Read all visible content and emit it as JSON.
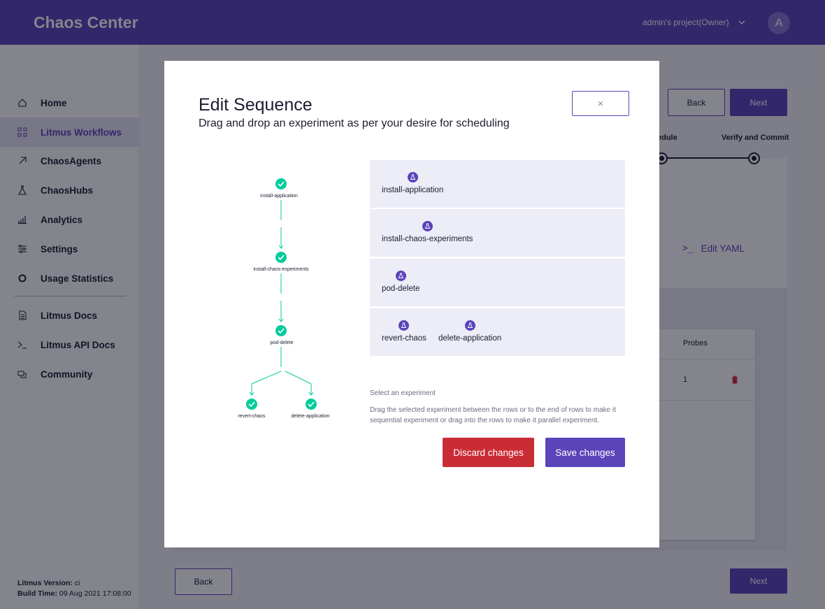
{
  "app": {
    "brand": "Chaos Center",
    "project": "admin's project(Owner)",
    "avatar_initial": "A"
  },
  "sidebar": {
    "items": [
      {
        "label": "Home",
        "icon": "home-icon"
      },
      {
        "label": "Litmus Workflows",
        "icon": "workflows-icon",
        "active": true
      },
      {
        "label": "ChaosAgents",
        "icon": "agents-icon"
      },
      {
        "label": "ChaosHubs",
        "icon": "hubs-icon"
      },
      {
        "label": "Analytics",
        "icon": "analytics-icon"
      },
      {
        "label": "Settings",
        "icon": "settings-icon"
      },
      {
        "label": "Usage Statistics",
        "icon": "usage-icon"
      },
      {
        "label": "Litmus Docs",
        "icon": "docs-icon"
      },
      {
        "label": "Litmus API Docs",
        "icon": "terminal-icon"
      },
      {
        "label": "Community",
        "icon": "community-icon"
      }
    ],
    "version_label": "Litmus Version:",
    "version_value": "ci",
    "build_label": "Build Time:",
    "build_value": "09 Aug 2021 17:08:00"
  },
  "background": {
    "back_label": "Back",
    "next_label": "Next",
    "step_schedule": "edule",
    "step_verify": "Verify and Commit",
    "edit_yaml": "Edit YAML",
    "table_header_probes": "Probes",
    "table_probes_value": "1",
    "bottom_back": "Back",
    "bottom_next": "Next"
  },
  "modal": {
    "title": "Edit Sequence",
    "subtitle": "Drag and drop an experiment as per your desire for scheduling",
    "close_symbol": "×",
    "graph_nodes": [
      "install-application",
      "install-chaos-experiments",
      "pod-delete",
      "revert-chaos",
      "delete-application"
    ],
    "sequence_rows": [
      [
        "install-application"
      ],
      [
        "install-chaos-experiments"
      ],
      [
        "pod-delete"
      ],
      [
        "revert-chaos",
        "delete-application"
      ]
    ],
    "select_title": "Select an experiment",
    "select_desc": "Drag the selected experiment between the rows or to the end of rows to make it sequential experiment or drag into the rows to make it parallel experiment.",
    "discard_label": "Discard changes",
    "save_label": "Save changes"
  },
  "colors": {
    "primary": "#5b44ba",
    "success": "#00cc9a",
    "danger": "#ca2c36"
  }
}
